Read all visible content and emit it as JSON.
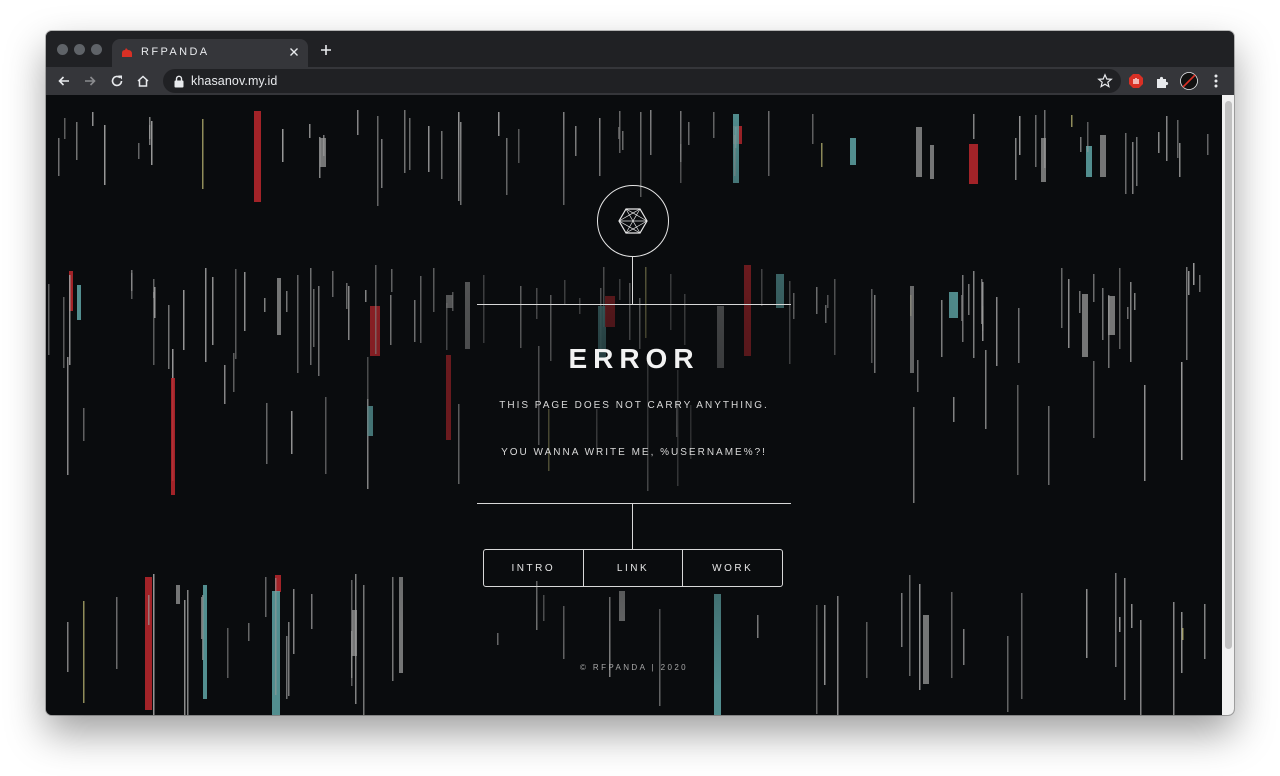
{
  "browser": {
    "tab_title": "RFPANDA",
    "address": "khasanov.my.id",
    "new_tab_symbol": "+"
  },
  "page": {
    "heading": "ERROR",
    "message_1": "THIS PAGE DOES NOT CARRY ANYTHING.",
    "message_2": "YOU WANNA WRITE ME, %USERNAME%?!",
    "nav": [
      {
        "label": "INTRO"
      },
      {
        "label": "LINK"
      },
      {
        "label": "WORK"
      }
    ],
    "footer": "© RFPANDA | 2020"
  },
  "colors": {
    "page_background": "#0a0c0e",
    "accent_red": "#b3262b",
    "accent_teal": "#5fa6a6",
    "streak_grey": "#9a9a9a",
    "favicon_red": "#d93025"
  }
}
